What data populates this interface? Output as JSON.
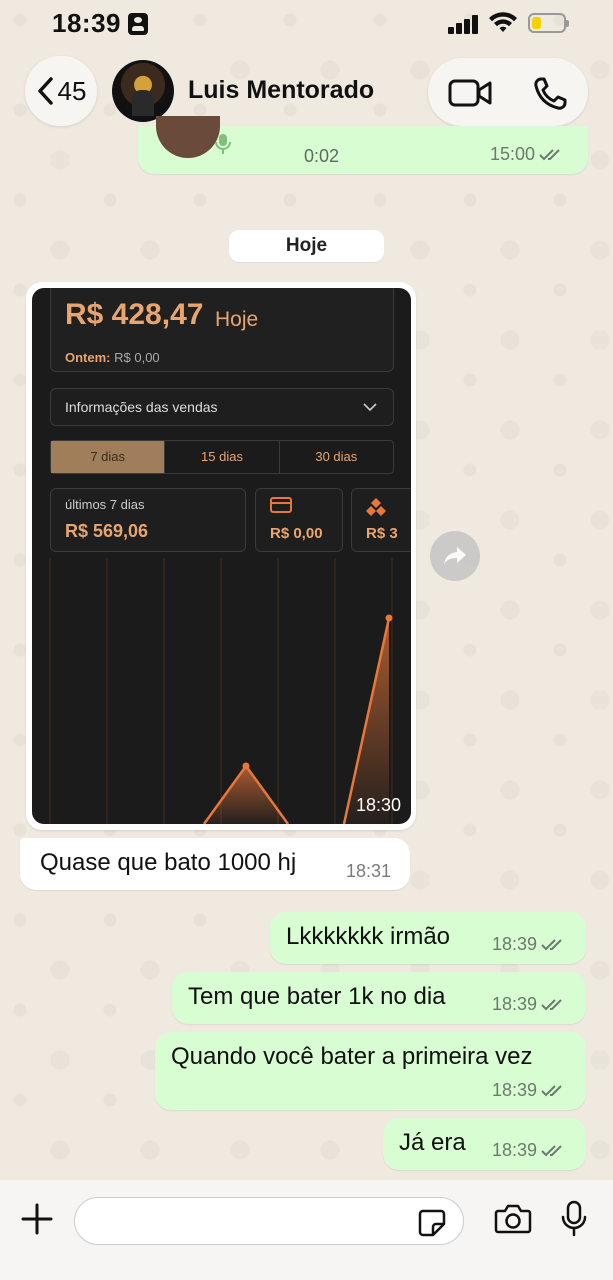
{
  "status_bar": {
    "time": "18:39"
  },
  "header": {
    "back_count": "45",
    "contact_name": "Luis Mentorado"
  },
  "messages": {
    "audio": {
      "duration": "0:02",
      "time": "15:00"
    },
    "day_separator": "Hoje",
    "image": {
      "time": "18:30",
      "content": {
        "big_value": "R$ 428,47",
        "big_suffix": "Hoje",
        "yesterday_label": "Ontem:",
        "yesterday_value": "R$ 0,00",
        "dropdown": "Informações das vendas",
        "periods": [
          "7 dias",
          "15 dias",
          "30 dias"
        ],
        "active_period": "7 dias",
        "card_label": "últimos 7 dias",
        "card_value": "R$ 569,06",
        "card2_value": "R$ 0,00",
        "card3_value": "R$ 3"
      }
    },
    "incoming_1": {
      "text": "Quase que bato 1000 hj",
      "time": "18:31"
    },
    "out_1": {
      "text": "Lkkkkkkk irmão",
      "time": "18:39"
    },
    "out_2": {
      "text": "Tem que bater 1k no dia",
      "time": "18:39"
    },
    "out_3": {
      "text": "Quando você bater a primeira vez",
      "time": "18:39"
    },
    "out_4": {
      "text": "Já era",
      "time": "18:39"
    }
  },
  "colors": {
    "outgoing_bubble": "#d9fdd3",
    "incoming_bubble": "#ffffff",
    "accent_gold": "#e8a570",
    "read_tick": "#6b7a6c"
  },
  "icons": [
    "back-chevron",
    "video-call",
    "phone-call",
    "forward",
    "plus",
    "sticker",
    "camera",
    "microphone"
  ]
}
